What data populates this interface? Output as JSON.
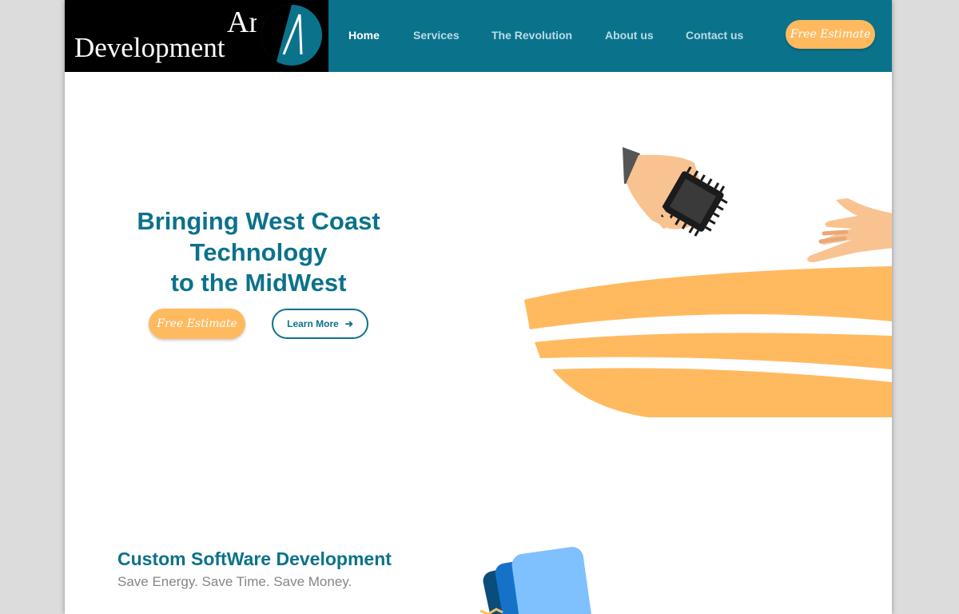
{
  "logo": {
    "line1": "Arc",
    "line2": "Development"
  },
  "nav": {
    "items": [
      {
        "label": "Home"
      },
      {
        "label": "Services"
      },
      {
        "label": "The Revolution"
      },
      {
        "label": "About us"
      },
      {
        "label": "Contact us"
      }
    ],
    "active": "Home",
    "estimate_label": "Free Estimate"
  },
  "hero": {
    "title_lines": [
      "Bringing West Coast",
      "Technology",
      "to the MidWest"
    ],
    "estimate_label": "Free Estimate",
    "learn_more_label": "Learn More"
  },
  "section": {
    "title": "Custom SoftWare Development",
    "subtitle": "Save Energy. Save Time. Save Money."
  },
  "colors": {
    "brand_blue": "#0b728b",
    "accent_orange": "#ffba60",
    "header_black": "#000000",
    "subtitle_gray": "#868686"
  },
  "icons": [
    "arrow-right-icon",
    "logo-mark-icon",
    "handshake-chip-illustration",
    "software-cards-illustration"
  ]
}
